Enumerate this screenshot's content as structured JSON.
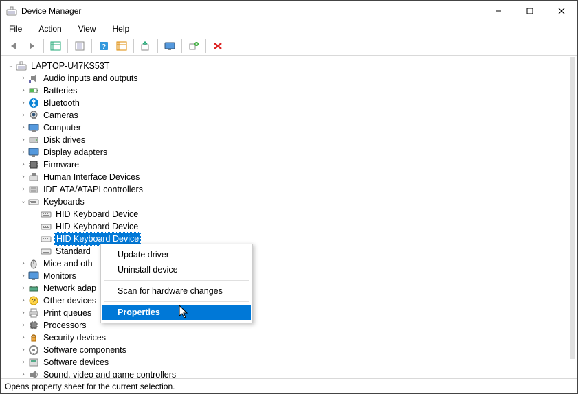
{
  "window": {
    "title": "Device Manager"
  },
  "menubar": [
    "File",
    "Action",
    "View",
    "Help"
  ],
  "toolbar_icons": [
    "nav-back-icon",
    "nav-forward-icon",
    "show-hidden-icon",
    "properties-icon",
    "help-icon",
    "scan-changes-icon",
    "update-driver-icon",
    "add-legacy-icon",
    "uninstall-icon",
    "disable-icon"
  ],
  "tree": {
    "root": "LAPTOP-U47KS53T",
    "root_expanded": true,
    "categories": [
      {
        "icon": "audio",
        "label": "Audio inputs and outputs",
        "expanded": false
      },
      {
        "icon": "battery",
        "label": "Batteries",
        "expanded": false
      },
      {
        "icon": "bluetooth",
        "label": "Bluetooth",
        "expanded": false
      },
      {
        "icon": "camera",
        "label": "Cameras",
        "expanded": false
      },
      {
        "icon": "computer",
        "label": "Computer",
        "expanded": false
      },
      {
        "icon": "disk",
        "label": "Disk drives",
        "expanded": false
      },
      {
        "icon": "display",
        "label": "Display adapters",
        "expanded": false
      },
      {
        "icon": "firmware",
        "label": "Firmware",
        "expanded": false
      },
      {
        "icon": "hid",
        "label": "Human Interface Devices",
        "expanded": false
      },
      {
        "icon": "ide",
        "label": "IDE ATA/ATAPI controllers",
        "expanded": false
      },
      {
        "icon": "keyboard",
        "label": "Keyboards",
        "expanded": true,
        "children": [
          {
            "icon": "keyboard",
            "label": "HID Keyboard Device",
            "selected": false
          },
          {
            "icon": "keyboard",
            "label": "HID Keyboard Device",
            "selected": false
          },
          {
            "icon": "keyboard",
            "label": "HID Keyboard Device",
            "selected": true
          },
          {
            "icon": "keyboard",
            "label": "Standard",
            "selected": false
          }
        ]
      },
      {
        "icon": "mouse",
        "label": "Mice and oth",
        "expanded": false
      },
      {
        "icon": "monitor",
        "label": "Monitors",
        "expanded": false
      },
      {
        "icon": "network",
        "label": "Network adap",
        "expanded": false
      },
      {
        "icon": "other",
        "label": "Other devices",
        "expanded": false
      },
      {
        "icon": "printer",
        "label": "Print queues",
        "expanded": false
      },
      {
        "icon": "cpu",
        "label": "Processors",
        "expanded": false
      },
      {
        "icon": "security",
        "label": "Security devices",
        "expanded": false
      },
      {
        "icon": "component",
        "label": "Software components",
        "expanded": false
      },
      {
        "icon": "swdev",
        "label": "Software devices",
        "expanded": false
      },
      {
        "icon": "sound",
        "label": "Sound, video and game controllers",
        "expanded": false
      }
    ]
  },
  "context_menu": {
    "items": [
      {
        "label": "Update driver"
      },
      {
        "label": "Uninstall device"
      },
      {
        "separator": true
      },
      {
        "label": "Scan for hardware changes"
      },
      {
        "separator": true
      },
      {
        "label": "Properties",
        "highlight": true
      }
    ]
  },
  "statusbar": "Opens property sheet for the current selection."
}
